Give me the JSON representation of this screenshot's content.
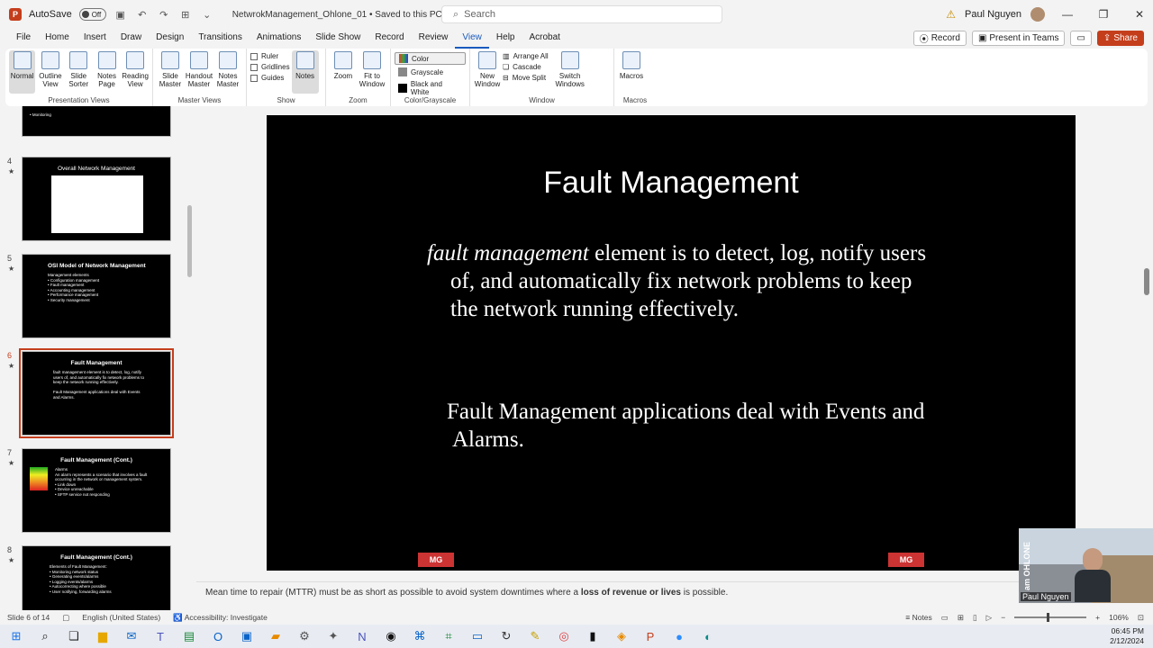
{
  "titlebar": {
    "autosave_label": "AutoSave",
    "autosave_state": "Off",
    "doc_title": "NetwrokManagement_Ohlone_01 • Saved to this PC",
    "search_placeholder": "Search",
    "user_name": "Paul Nguyen"
  },
  "tabs": [
    "File",
    "Home",
    "Insert",
    "Draw",
    "Design",
    "Transitions",
    "Animations",
    "Slide Show",
    "Record",
    "Review",
    "View",
    "Help",
    "Acrobat"
  ],
  "active_tab": "View",
  "tab_actions": {
    "record": "Record",
    "present": "Present in Teams",
    "share": "Share"
  },
  "ribbon": {
    "presentation_views": {
      "label": "Presentation Views",
      "buttons": [
        "Normal",
        "Outline View",
        "Slide Sorter",
        "Notes Page",
        "Reading View"
      ]
    },
    "master_views": {
      "label": "Master Views",
      "buttons": [
        "Slide Master",
        "Handout Master",
        "Notes Master"
      ]
    },
    "show": {
      "label": "Show",
      "checks": [
        "Ruler",
        "Gridlines",
        "Guides"
      ],
      "notes_button": "Notes"
    },
    "zoom": {
      "label": "Zoom",
      "buttons": [
        "Zoom",
        "Fit to Window"
      ]
    },
    "color": {
      "label": "Color/Grayscale",
      "items": [
        "Color",
        "Grayscale",
        "Black and White"
      ]
    },
    "window": {
      "label": "Window",
      "new_window": "New Window",
      "items": [
        "Arrange All",
        "Cascade",
        "Move Split"
      ],
      "switch": "Switch Windows"
    },
    "macros": {
      "label": "Macros",
      "button": "Macros"
    }
  },
  "thumbnails": [
    {
      "num": "",
      "title": "",
      "body": "• Monitoring"
    },
    {
      "num": "4",
      "title": "Overall Network Management",
      "body": ""
    },
    {
      "num": "5",
      "title": "OSI Model of Network Management",
      "body": "Management elements\n• Configuration management\n• Fault management\n• Accounting management\n• Performance management\n• Security management"
    },
    {
      "num": "6",
      "title": "Fault Management",
      "body": "fault management element is to detect, log, notify users of, and automatically fix network problems to keep the network running effectively.\n\nFault Management applications deal with Events and Alarms."
    },
    {
      "num": "7",
      "title": "Fault Management (Cont.)",
      "body": "Alarms\nAn alarm represents a scenario that involves a fault occurring in the network or management system.\n• Link down\n• Device unreachable\n• SFTP service not responding"
    },
    {
      "num": "8",
      "title": "Fault Management (Cont.)",
      "body": "Elements of Fault Management:\n• Monitoring network status\n• Generating events/alarms\n• Logging events/alarms\n• Autocorrecting where possible\n• User notifying, forwarding alarms"
    }
  ],
  "slide": {
    "title": "Fault Management",
    "p1_italic": "fault management",
    "p1_rest": " element is to detect, log, notify users of, and automatically fix network problems to keep the network running effectively.",
    "p2": "Fault Management applications deal with Events and Alarms.",
    "logo_text": "MG"
  },
  "notes": {
    "before": "Mean time to repair (MTTR) must be as short as possible to avoid system downtimes where a ",
    "bold": "loss of revenue or lives",
    "after": " is possible."
  },
  "webcam": {
    "name": "Paul Nguyen",
    "brand": "I am OHLONE"
  },
  "status": {
    "slide": "Slide 6 of 14",
    "language": "English (United States)",
    "accessibility": "Accessibility: Investigate",
    "notes": "Notes",
    "zoom": "106%"
  },
  "clock": {
    "time": "06:45 PM",
    "date": "2/12/2024"
  },
  "colors": {
    "accent": "#185abd",
    "brand": "#c43e1c"
  }
}
